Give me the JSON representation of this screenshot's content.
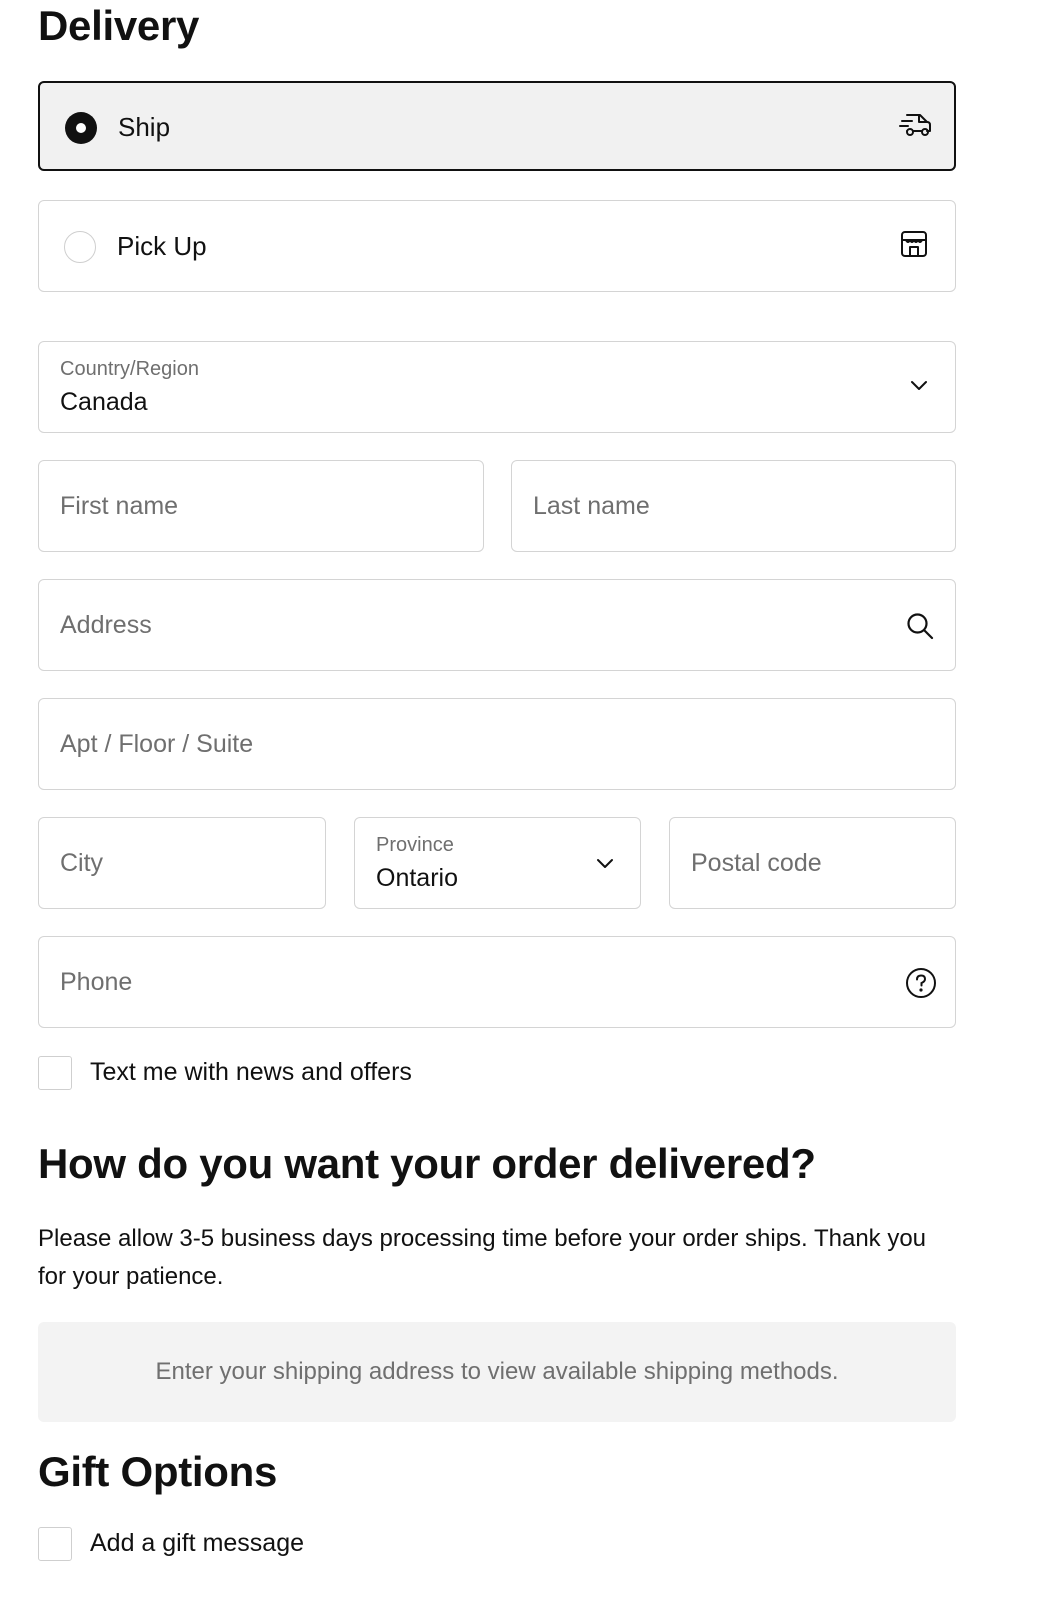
{
  "delivery": {
    "title": "Delivery",
    "options": [
      {
        "label": "Ship",
        "selected": true,
        "icon": "truck-icon"
      },
      {
        "label": "Pick Up",
        "selected": false,
        "icon": "store-icon"
      }
    ]
  },
  "form": {
    "country": {
      "label": "Country/Region",
      "value": "Canada"
    },
    "first_name": {
      "placeholder": "First name"
    },
    "last_name": {
      "placeholder": "Last name"
    },
    "address": {
      "placeholder": "Address"
    },
    "apt": {
      "placeholder": "Apt / Floor / Suite"
    },
    "city": {
      "placeholder": "City"
    },
    "province": {
      "label": "Province",
      "value": "Ontario"
    },
    "postal_code": {
      "placeholder": "Postal code"
    },
    "phone": {
      "placeholder": "Phone"
    },
    "sms_optin": {
      "label": "Text me with news and offers",
      "checked": false
    }
  },
  "shipping": {
    "title": "How do you want your order delivered?",
    "description": "Please allow 3-5 business days processing time before your order ships. Thank you for your patience.",
    "notice": "Enter your shipping address to view available shipping methods."
  },
  "gift": {
    "title": "Gift Options",
    "message_option": {
      "label": "Add a gift message",
      "checked": false
    }
  }
}
